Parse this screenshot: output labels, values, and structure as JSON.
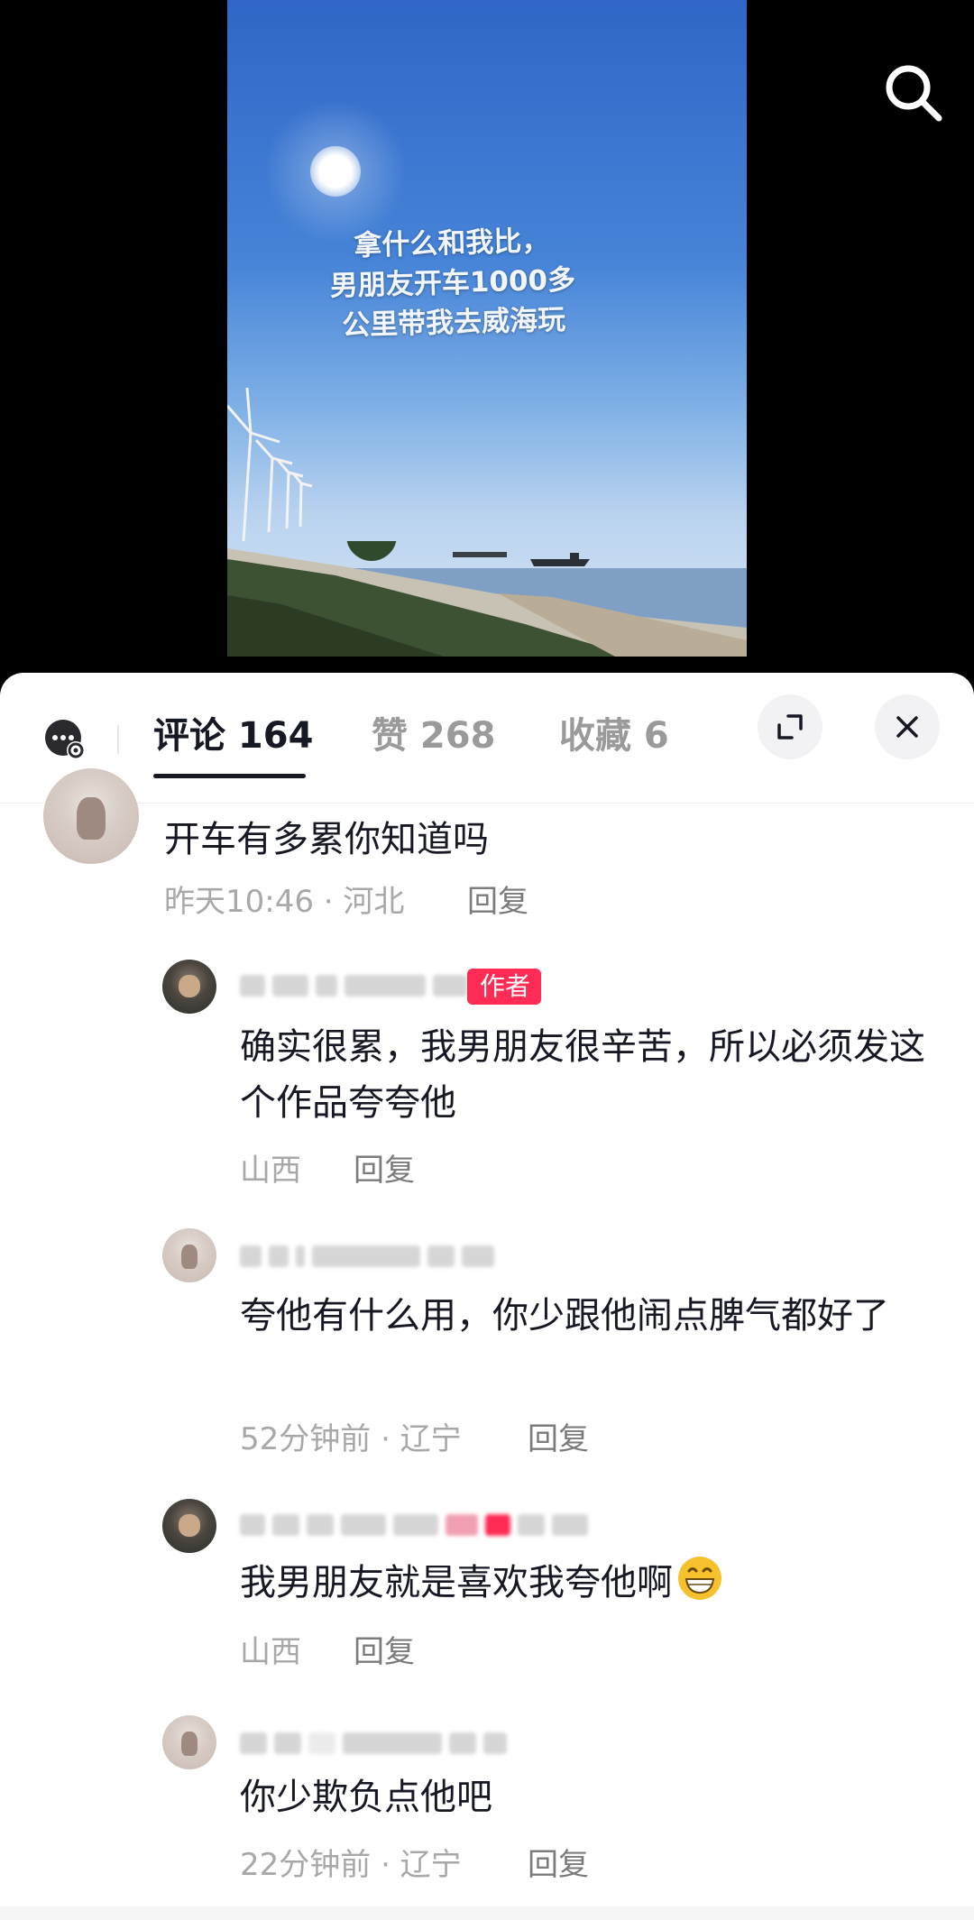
{
  "video": {
    "caption": "拿什么和我比，\n男朋友开车1000多\n公里带我去威海玩"
  },
  "tabs": {
    "comments": "评论 164",
    "likes": "赞 268",
    "favorites": "收藏 6"
  },
  "comments": [
    {
      "text": "开车有多累你知道吗",
      "time_location": "昨天10:46 · 河北",
      "reply_label": "回复"
    },
    {
      "badge": "作者",
      "text": "确实很累，我男朋友很辛苦，所以必须发这个作品夸夸他",
      "time_location": "山西",
      "reply_label": "回复"
    },
    {
      "text": "夸他有什么用，你少跟他闹点脾气都好了",
      "time_location": "52分钟前 · 辽宁",
      "reply_label": "回复"
    },
    {
      "text": "我男朋友就是喜欢我夸他啊",
      "emoji": "grin-emoji",
      "time_location": "山西",
      "reply_label": "回复"
    },
    {
      "text": "你少欺负点他吧",
      "time_location": "22分钟前 · 辽宁",
      "reply_label": "回复"
    }
  ],
  "icons": {
    "search": "search-icon",
    "chat": "chat-settings-icon",
    "expand": "expand-icon",
    "close": "close-icon"
  },
  "colors": {
    "author_badge": "#fe2c55",
    "text_primary": "#161823",
    "text_meta": "#a8a8a8"
  }
}
